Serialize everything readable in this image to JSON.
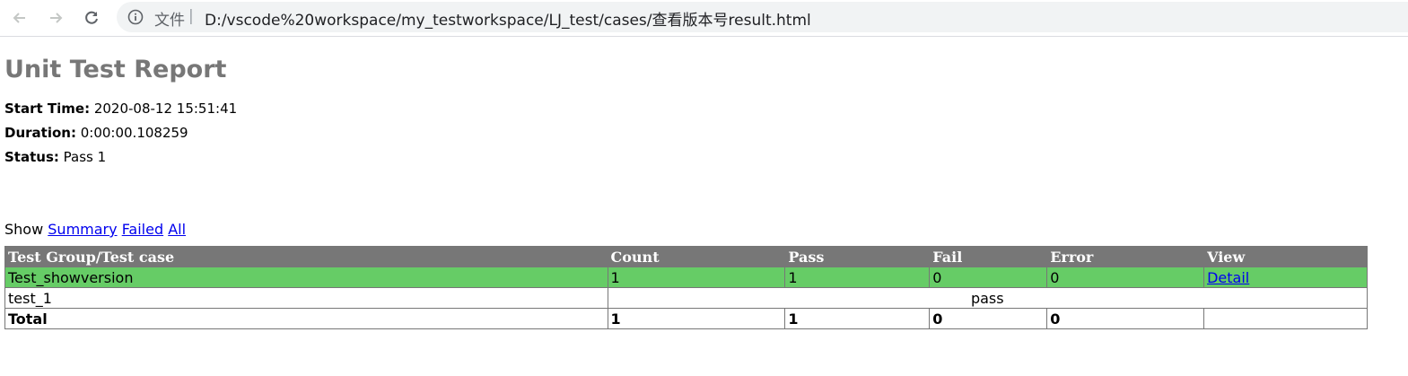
{
  "browser": {
    "site_label": "文件",
    "separator": "|",
    "url": "D:/vscode%20workspace/my_testworkspace/LJ_test/cases/查看版本号result.html"
  },
  "report": {
    "title": "Unit Test Report",
    "start_time_label": "Start Time:",
    "start_time": "2020-08-12 15:51:41",
    "duration_label": "Duration:",
    "duration": "0:00:00.108259",
    "status_label": "Status:",
    "status": "Pass 1",
    "show_label": "Show",
    "show_links": [
      "Summary",
      "Failed",
      "All"
    ]
  },
  "table": {
    "headers": [
      "Test Group/Test case",
      "Count",
      "Pass",
      "Fail",
      "Error",
      "View"
    ],
    "group": {
      "name": "Test_showversion",
      "count": "1",
      "pass": "1",
      "fail": "0",
      "error": "0",
      "view": "Detail"
    },
    "case": {
      "name": "test_1",
      "status": "pass"
    },
    "total": {
      "label": "Total",
      "count": "1",
      "pass": "1",
      "fail": "0",
      "error": "0"
    }
  },
  "colors": {
    "header_bg": "#777777",
    "pass_row_bg": "#66cc66",
    "title_color": "#777777",
    "link_color": "#0000ee"
  }
}
